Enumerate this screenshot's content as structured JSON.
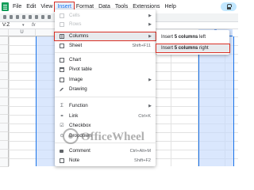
{
  "menubar": {
    "items": [
      {
        "label": "File",
        "active": false
      },
      {
        "label": "Edit",
        "active": false
      },
      {
        "label": "View",
        "active": false
      },
      {
        "label": "Insert",
        "active": true
      },
      {
        "label": "Format",
        "active": false
      },
      {
        "label": "Data",
        "active": false
      },
      {
        "label": "Tools",
        "active": false
      },
      {
        "label": "Extensions",
        "active": false
      },
      {
        "label": "Help",
        "active": false
      }
    ]
  },
  "formula_bar": {
    "name_box": "V:Z",
    "name_box_arrow": "▾",
    "fx_label": "fx"
  },
  "grid": {
    "column_headers": [
      "",
      "",
      "",
      "",
      "",
      "",
      "",
      "",
      ""
    ],
    "selected_header_label": "Z",
    "left_header_label": "U"
  },
  "insert_menu": {
    "items": [
      {
        "label": "Cells",
        "shortcut": "",
        "icon": "cells-icon",
        "disabled": true,
        "submenu": true
      },
      {
        "label": "Rows",
        "shortcut": "",
        "icon": "rows-icon",
        "disabled": true,
        "submenu": true
      },
      {
        "label": "Columns",
        "shortcut": "",
        "icon": "columns-icon",
        "disabled": false,
        "submenu": true,
        "highlighted": true
      },
      {
        "label": "Sheet",
        "shortcut": "Shift+F11",
        "icon": "sheet-icon",
        "disabled": false
      },
      {
        "label": "Chart",
        "shortcut": "",
        "icon": "chart-icon",
        "disabled": false
      },
      {
        "label": "Pivot table",
        "shortcut": "",
        "icon": "pivot-table-icon",
        "disabled": false
      },
      {
        "label": "Image",
        "shortcut": "",
        "icon": "image-icon",
        "disabled": false,
        "submenu": true
      },
      {
        "label": "Drawing",
        "shortcut": "",
        "icon": "drawing-icon",
        "disabled": false
      },
      {
        "label": "Function",
        "shortcut": "",
        "icon": "function-icon",
        "disabled": false,
        "submenu": true
      },
      {
        "label": "Link",
        "shortcut": "Ctrl+K",
        "icon": "link-icon",
        "disabled": false
      },
      {
        "label": "Checkbox",
        "shortcut": "",
        "icon": "checkbox-icon",
        "disabled": false
      },
      {
        "label": "Dropdown",
        "shortcut": "",
        "icon": "dropdown-icon",
        "disabled": false
      },
      {
        "label": "Comment",
        "shortcut": "Ctrl+Alt+M",
        "icon": "comment-icon",
        "disabled": false
      },
      {
        "label": "Note",
        "shortcut": "Shift+F2",
        "icon": "note-icon",
        "disabled": false
      }
    ]
  },
  "columns_submenu": {
    "items": [
      {
        "prefix": "Insert ",
        "bold": "5 columns",
        "suffix": " left",
        "highlighted": false
      },
      {
        "prefix": "Insert ",
        "bold": "5 columns",
        "suffix": " right",
        "highlighted": true
      }
    ]
  },
  "watermark": {
    "text": "OfficeWheel"
  },
  "colors": {
    "highlight_outline": "#d93025",
    "selection_fill": "#c6dafc",
    "accent_blue": "#1a73e8",
    "sheets_green": "#0f9d58"
  }
}
